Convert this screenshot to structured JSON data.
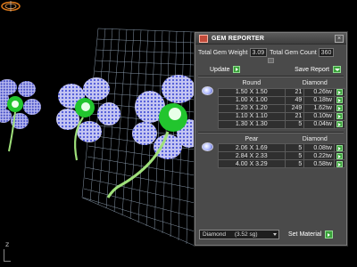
{
  "panel": {
    "title": "GEM REPORTER",
    "total_weight_label": "Total Gem Weight",
    "total_weight_value": "3.09",
    "total_count_label": "Total Gem Count",
    "total_count_value": "360",
    "update_label": "Update",
    "save_report_label": "Save Report"
  },
  "round": {
    "shape_label": "Round",
    "material_label": "Diamond",
    "rows": [
      {
        "size": "1.50 X 1.50",
        "count": "21",
        "ctw": "0.26tw"
      },
      {
        "size": "1.00 X 1.00",
        "count": "49",
        "ctw": "0.18tw"
      },
      {
        "size": "1.20 X 1.20",
        "count": "249",
        "ctw": "1.62tw"
      },
      {
        "size": "1.10 X 1.10",
        "count": "21",
        "ctw": "0.10tw"
      },
      {
        "size": "1.30 X 1.30",
        "count": "5",
        "ctw": "0.04tw"
      }
    ]
  },
  "pear": {
    "shape_label": "Pear",
    "material_label": "Diamond",
    "rows": [
      {
        "size": "2.06 X 1.69",
        "count": "5",
        "ctw": "0.08tw"
      },
      {
        "size": "2.84 X 2.33",
        "count": "5",
        "ctw": "0.22tw"
      },
      {
        "size": "4.00 X 3.29",
        "count": "5",
        "ctw": "0.58tw"
      }
    ]
  },
  "material": {
    "selected": "Diamond",
    "sg": "(3.52 sg)",
    "set_label": "Set Material"
  },
  "viewport": {
    "axis_label": "z"
  },
  "colors": {
    "accent_green": "#3aa23a",
    "gem_blue": "#4b56d8",
    "petal_lilac": "#b7b8ee",
    "center_green": "#22c52e",
    "stem_green": "#9fe07a",
    "grid_line": "#b8c8d8"
  },
  "icons": [
    "gem-reporter-icon",
    "close-icon",
    "round-gem-icon",
    "pear-gem-icon",
    "compass-icon"
  ]
}
